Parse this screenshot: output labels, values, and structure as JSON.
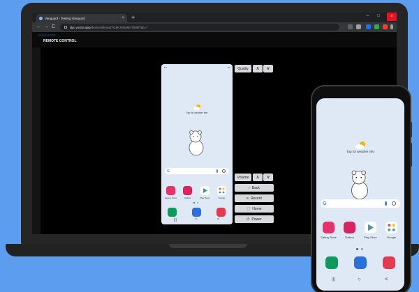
{
  "browser": {
    "tab_title": "Vanguard - Testing Vanguard",
    "tab_close": "×",
    "new_tab": "+",
    "minimize": "–",
    "maximize": "□",
    "close": "×",
    "back": "←",
    "forward": "→",
    "reload": "C",
    "url_host": "dpc.vostra.app",
    "url_path": "/devices/ikmaZ?G8KJ/GtyMr/Tb8k/Tab=7"
  },
  "app": {
    "logo": "VANGUARD",
    "section_title": "REMOTE CONTROL"
  },
  "remote_controls": {
    "quality_label": "Quality",
    "volume_label": "Volume",
    "up_arrow": "∧",
    "down_arrow": "∨",
    "back_label": "Back",
    "recent_label": "Recent",
    "home_label": "Home",
    "power_label": "Power"
  },
  "home_screen": {
    "weather_text": "Tap for weather info",
    "google_g": "G",
    "apps": [
      {
        "label": "Galaxy Store",
        "color": "#e5336b"
      },
      {
        "label": "Gallery",
        "color": "#d6265f"
      },
      {
        "label": "Play Store",
        "color": "#ffffff"
      },
      {
        "label": "Google",
        "color": "#ffffff"
      }
    ],
    "dock": [
      {
        "name": "phone",
        "color": "#0e9a5c"
      },
      {
        "name": "messages",
        "color": "#2a6fdb"
      },
      {
        "name": "camera",
        "color": "#e33a50"
      }
    ],
    "nav_recent": "|||",
    "nav_home": "○",
    "nav_back": "<"
  },
  "colors": {
    "background": "#5c9df0",
    "laptop_frame": "#262626",
    "screen": "#000000",
    "phone_wallpaper": "#dfe9f6",
    "control_button": "#d7d9dd"
  }
}
